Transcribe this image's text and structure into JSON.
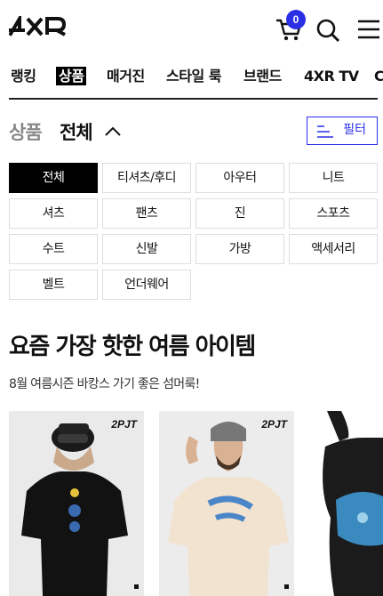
{
  "header": {
    "logo": "4XR",
    "cart_count": "0",
    "icons": [
      "cart-icon",
      "search-icon",
      "menu-icon"
    ],
    "accent_color": "#2a2ee5"
  },
  "nav": {
    "items": [
      {
        "label": "랭킹",
        "active": false
      },
      {
        "label": "상품",
        "active": true
      },
      {
        "label": "매거진",
        "active": false
      },
      {
        "label": "스타일 룩",
        "active": false
      },
      {
        "label": "브랜드",
        "active": false
      },
      {
        "label": "4XR TV",
        "active": false
      }
    ]
  },
  "section": {
    "crumb": "상품",
    "current": "전체",
    "filter_label": "필터"
  },
  "categories": [
    {
      "label": "전체",
      "active": true
    },
    {
      "label": "티셔츠/후디",
      "active": false
    },
    {
      "label": "아우터",
      "active": false
    },
    {
      "label": "니트",
      "active": false
    },
    {
      "label": "셔츠",
      "active": false
    },
    {
      "label": "팬츠",
      "active": false
    },
    {
      "label": "진",
      "active": false
    },
    {
      "label": "스포츠",
      "active": false
    },
    {
      "label": "수트",
      "active": false
    },
    {
      "label": "신발",
      "active": false
    },
    {
      "label": "가방",
      "active": false
    },
    {
      "label": "액세서리",
      "active": false
    },
    {
      "label": "벨트",
      "active": false
    },
    {
      "label": "언더웨어",
      "active": false
    }
  ],
  "promo": {
    "title": "요즘 가장 핫한 여름 아이템",
    "subtitle": "8월 여름시즌 바캉스 가기 좋은 섬머룩!"
  },
  "products": [
    {
      "brand": "2PJT",
      "shirt_color": "#111111"
    },
    {
      "brand": "2PJT",
      "shirt_color": "#f2e3d0"
    },
    {
      "brand": "",
      "shirt_color": "#1b1b1b"
    }
  ]
}
